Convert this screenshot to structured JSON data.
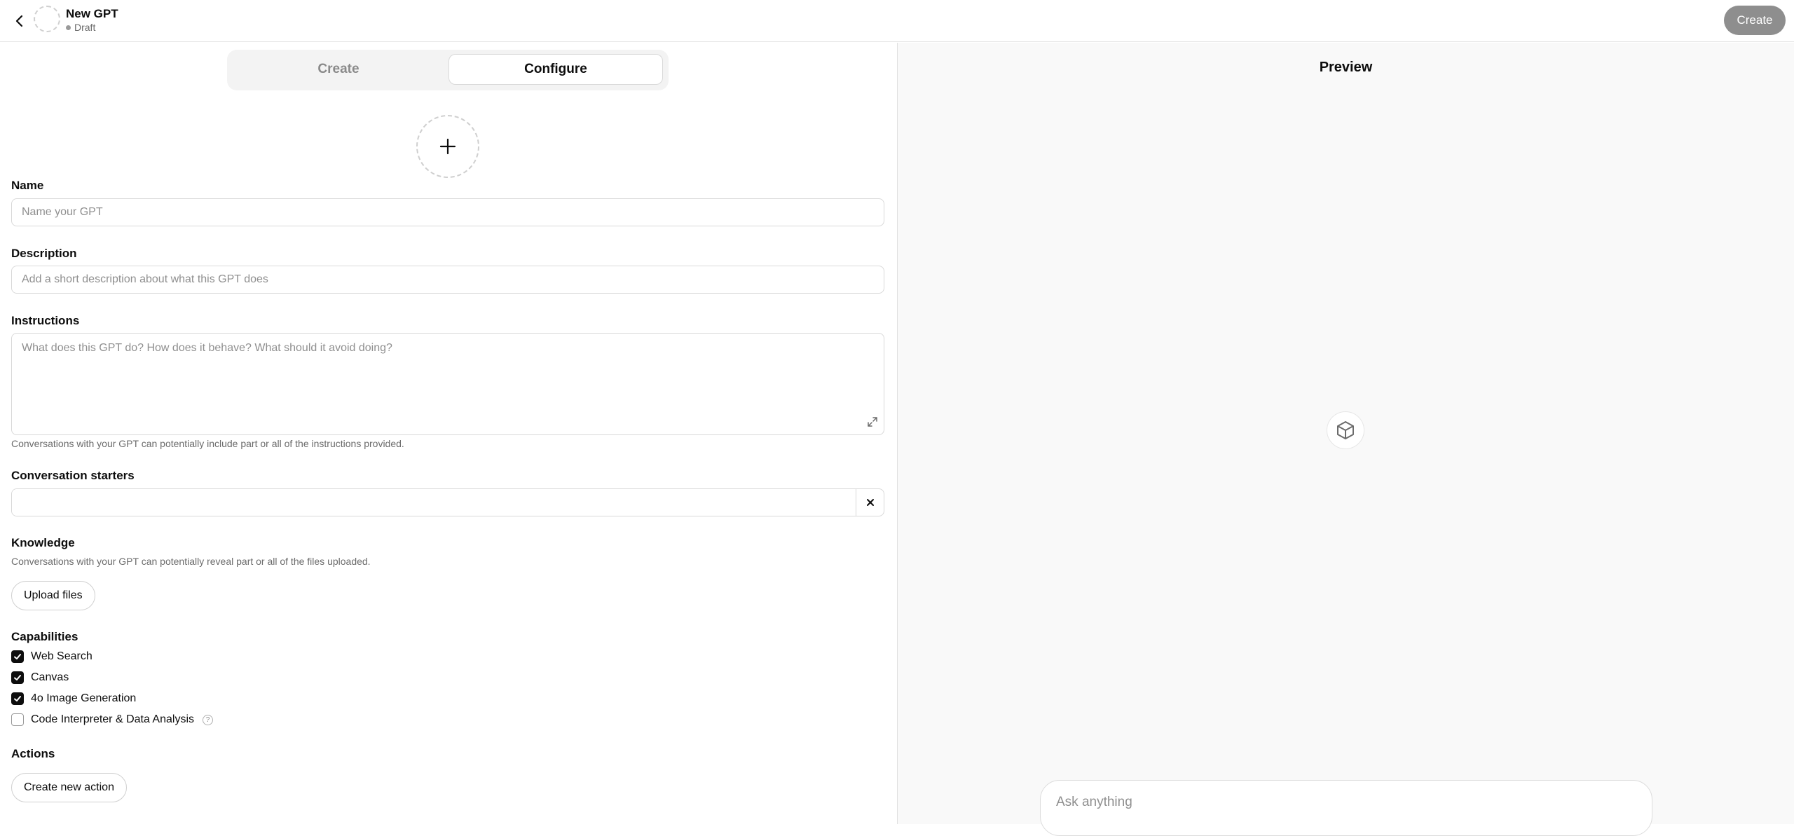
{
  "header": {
    "title": "New GPT",
    "status": "Draft",
    "create_label": "Create"
  },
  "tabs": [
    {
      "label": "Create",
      "active": false
    },
    {
      "label": "Configure",
      "active": true
    }
  ],
  "form": {
    "name": {
      "label": "Name",
      "value": "",
      "placeholder": "Name your GPT"
    },
    "description": {
      "label": "Description",
      "value": "",
      "placeholder": "Add a short description about what this GPT does"
    },
    "instructions": {
      "label": "Instructions",
      "value": "",
      "placeholder": "What does this GPT do? How does it behave? What should it avoid doing?",
      "hint": "Conversations with your GPT can potentially include part or all of the instructions provided."
    },
    "conversation_starters": {
      "label": "Conversation starters",
      "value": ""
    },
    "knowledge": {
      "label": "Knowledge",
      "hint": "Conversations with your GPT can potentially reveal part or all of the files uploaded.",
      "upload_label": "Upload files"
    },
    "capabilities": {
      "label": "Capabilities",
      "items": [
        {
          "label": "Web Search",
          "checked": true
        },
        {
          "label": "Canvas",
          "checked": true
        },
        {
          "label": "4o Image Generation",
          "checked": true
        },
        {
          "label": "Code Interpreter & Data Analysis",
          "checked": false
        }
      ]
    },
    "actions": {
      "label": "Actions",
      "create_label": "Create new action"
    }
  },
  "preview": {
    "title": "Preview",
    "input_placeholder": "Ask anything"
  },
  "colors": {
    "accent": "#0d0d0d",
    "create_button_bg": "#8e8e8e",
    "preview_bg": "#f9f9f9"
  }
}
